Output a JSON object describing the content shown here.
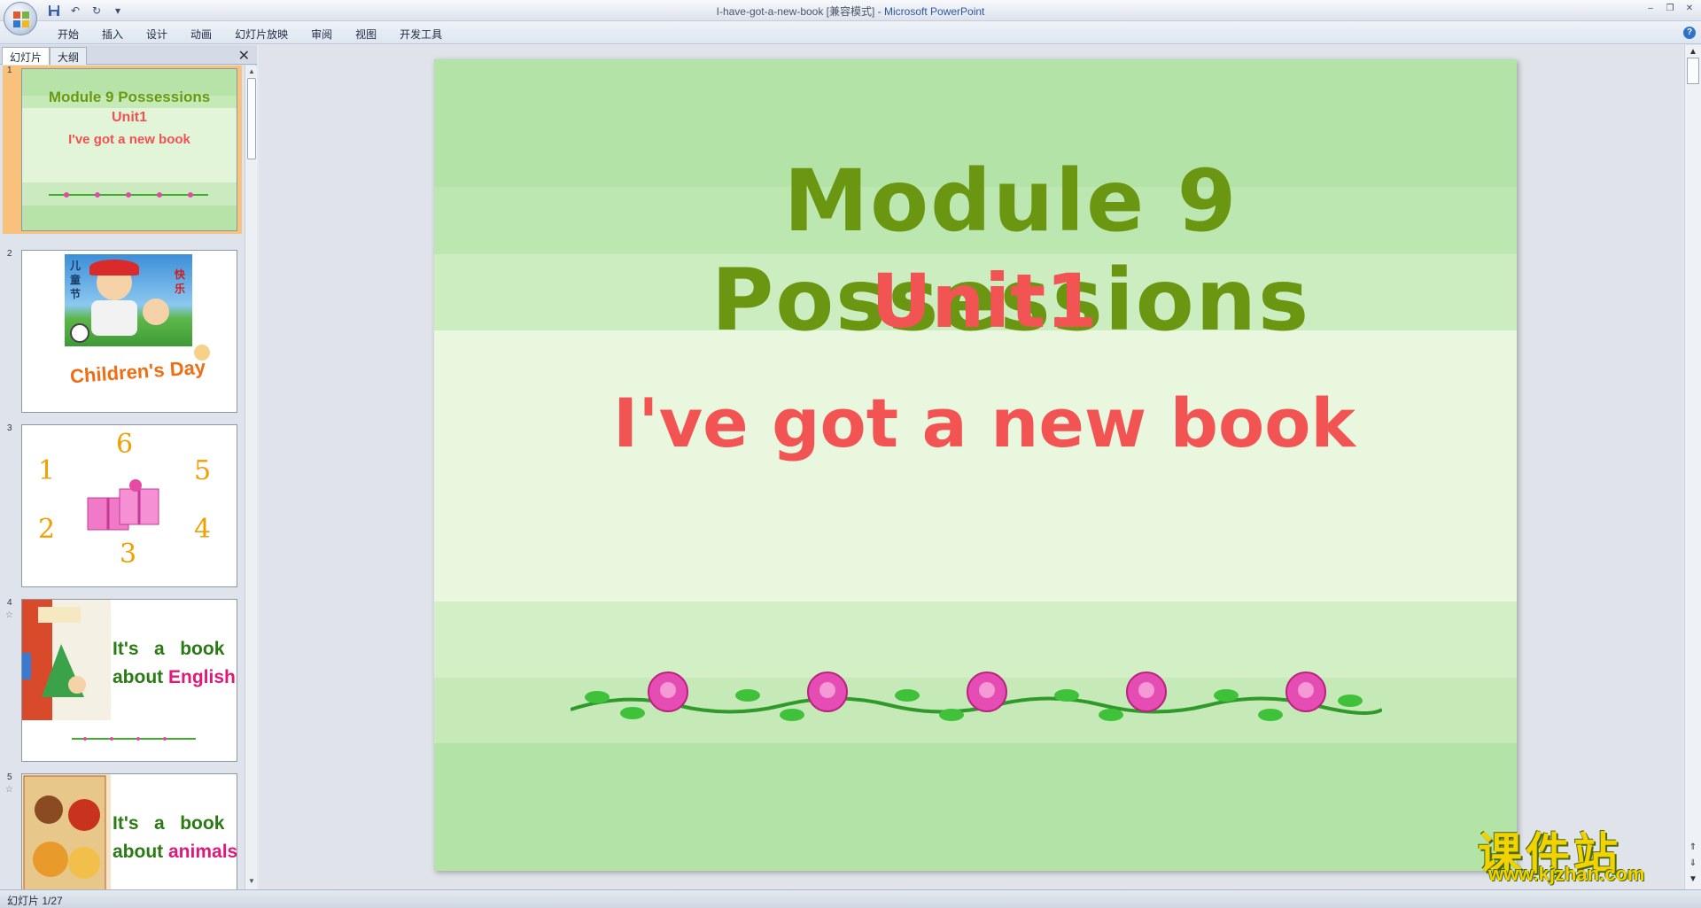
{
  "window": {
    "title": "I-have-got-a-new-book [兼容模式]",
    "title_separator": " - ",
    "app_name": "Microsoft PowerPoint"
  },
  "ribbon": {
    "tabs": [
      "开始",
      "插入",
      "设计",
      "动画",
      "幻灯片放映",
      "审阅",
      "视图",
      "开发工具"
    ]
  },
  "panel": {
    "tab_slides": "幻灯片",
    "tab_outline": "大纲",
    "thumbnails": [
      {
        "number": "1",
        "line1": "Module 9 Possessions",
        "line2": "Unit1",
        "line3": "I've got a new book"
      },
      {
        "number": "2",
        "cn_left": [
          "儿",
          "童",
          "节"
        ],
        "cn_right": [
          "快",
          "乐"
        ],
        "caption": "Children's Day"
      },
      {
        "number": "3",
        "numbers": [
          "6",
          "1",
          "5",
          "2",
          "4",
          "3"
        ]
      },
      {
        "number": "4",
        "line1_a": "It's",
        "line1_b": "a",
        "line1_c": "book",
        "line2_a": "about",
        "line2_b": "English"
      },
      {
        "number": "5",
        "line1_a": "It's",
        "line1_b": "a",
        "line1_c": "book",
        "line2_a": "about",
        "line2_b": "animals"
      }
    ]
  },
  "slide": {
    "title": "Module 9 Possessions",
    "unit": "Unit1",
    "subtitle": "I've got a new book",
    "background_color": "#eef8e6",
    "title_color": "#6a9612",
    "accent_color": "#f25454"
  },
  "watermark": {
    "cn": "课件站",
    "url": "www.kjzhan.com"
  },
  "statusbar": {
    "slide_info": "幻灯片 1/27"
  }
}
